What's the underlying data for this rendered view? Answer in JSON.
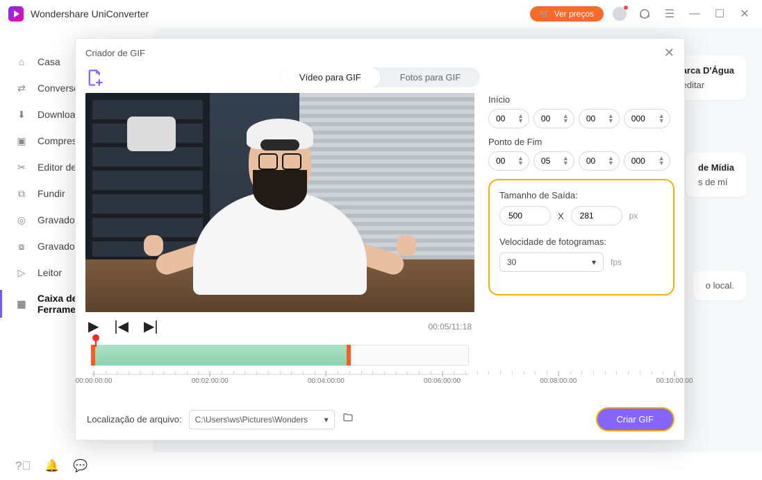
{
  "app": {
    "title": "Wondershare UniConverter"
  },
  "titlebar": {
    "price_label": "Ver preços"
  },
  "sidebar": {
    "items": [
      {
        "label": "Casa"
      },
      {
        "label": "Conversor"
      },
      {
        "label": "Download"
      },
      {
        "label": "Compressor"
      },
      {
        "label": "Editor de vídeo"
      },
      {
        "label": "Fundir"
      },
      {
        "label": "Gravador de CD"
      },
      {
        "label": "Gravador de Tela"
      },
      {
        "label": "Leitor"
      },
      {
        "label": "Caixa de Ferramentas"
      }
    ]
  },
  "bg_cards": {
    "c1_title": "Marca D'Água",
    "c1_sub": "e editar",
    "c2_title": "de Mídia",
    "c2_sub": "s de mí",
    "c3_sub": "o local."
  },
  "modal": {
    "title": "Criador de GIF",
    "tabs": {
      "video": "Vídeo para GIF",
      "photos": "Fotos para GIF"
    },
    "time": "00:05/11:18",
    "start_label": "Início",
    "end_label": "Ponto de Fim",
    "start": {
      "h": "00",
      "m": "00",
      "s": "00",
      "ms": "000"
    },
    "end": {
      "h": "00",
      "m": "05",
      "s": "00",
      "ms": "000"
    },
    "size_label": "Tamanho de Saída:",
    "size": {
      "w": "500",
      "sep": "X",
      "h": "281",
      "unit": "px"
    },
    "fps_label": "Velocidade de fotogramas:",
    "fps_value": "30",
    "fps_unit": "fps",
    "loc_label": "Localização de arquivo:",
    "loc_value": "C:\\Users\\ws\\Pictures\\Wonders",
    "create_label": "Criar GIF",
    "ruler": [
      "00:00:00:00",
      "00:02:00:00",
      "00:04:00:00",
      "00:06:00:00",
      "00:08:00:00",
      "00:10:00:00"
    ]
  }
}
